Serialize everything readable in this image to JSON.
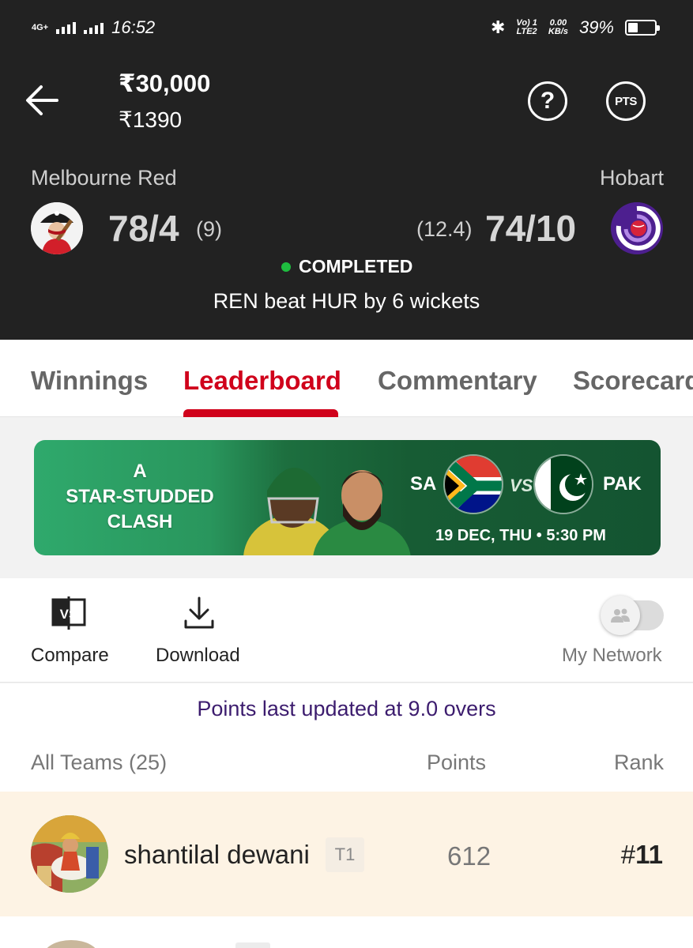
{
  "status_bar": {
    "network": "4G+",
    "time": "16:52",
    "volte": "Vo) 1",
    "lte": "LTE2",
    "speed_value": "0.00",
    "speed_unit": "KB/s",
    "battery": "39%",
    "battery_level": 0.39
  },
  "contest": {
    "prize_pool": "₹30,000",
    "entry_fee": "₹1390",
    "help_label": "?",
    "pts_label": "PTS"
  },
  "match": {
    "team_a": {
      "name": "Melbourne Red",
      "score": "78/4",
      "overs": "(9)"
    },
    "team_b": {
      "name": "Hobart",
      "score": "74/10",
      "overs": "(12.4)"
    },
    "state": "COMPLETED",
    "result": "REN beat HUR by 6 wickets"
  },
  "tabs": [
    {
      "label": "Winnings",
      "active": false
    },
    {
      "label": "Leaderboard",
      "active": true
    },
    {
      "label": "Commentary",
      "active": false
    },
    {
      "label": "Scorecard",
      "active": false
    }
  ],
  "banner": {
    "tagline_1": "A",
    "tagline_2": "STAR-STUDDED",
    "tagline_3": "CLASH",
    "team_1": "SA",
    "vs": "VS",
    "team_2": "PAK",
    "schedule": "19 DEC, THU • 5:30 PM"
  },
  "actions": {
    "compare": "Compare",
    "compare_icon_text": "VS",
    "download": "Download",
    "my_network": "My Network",
    "my_network_enabled": false
  },
  "leaderboard": {
    "updated_text": "Points last updated at 9.0 overs",
    "col_teams": "All Teams (25)",
    "col_points": "Points",
    "col_rank": "Rank",
    "rows": [
      {
        "name": "shantilal dewani",
        "team_tag": "T1",
        "points": "612",
        "rank_hash": "#",
        "rank": "11"
      }
    ]
  },
  "colors": {
    "accent": "#d0021b",
    "header_bg": "#222222",
    "status_green": "#1ebd3f",
    "highlight_row": "#fdf3e4",
    "info_purple": "#3c1c6e"
  }
}
